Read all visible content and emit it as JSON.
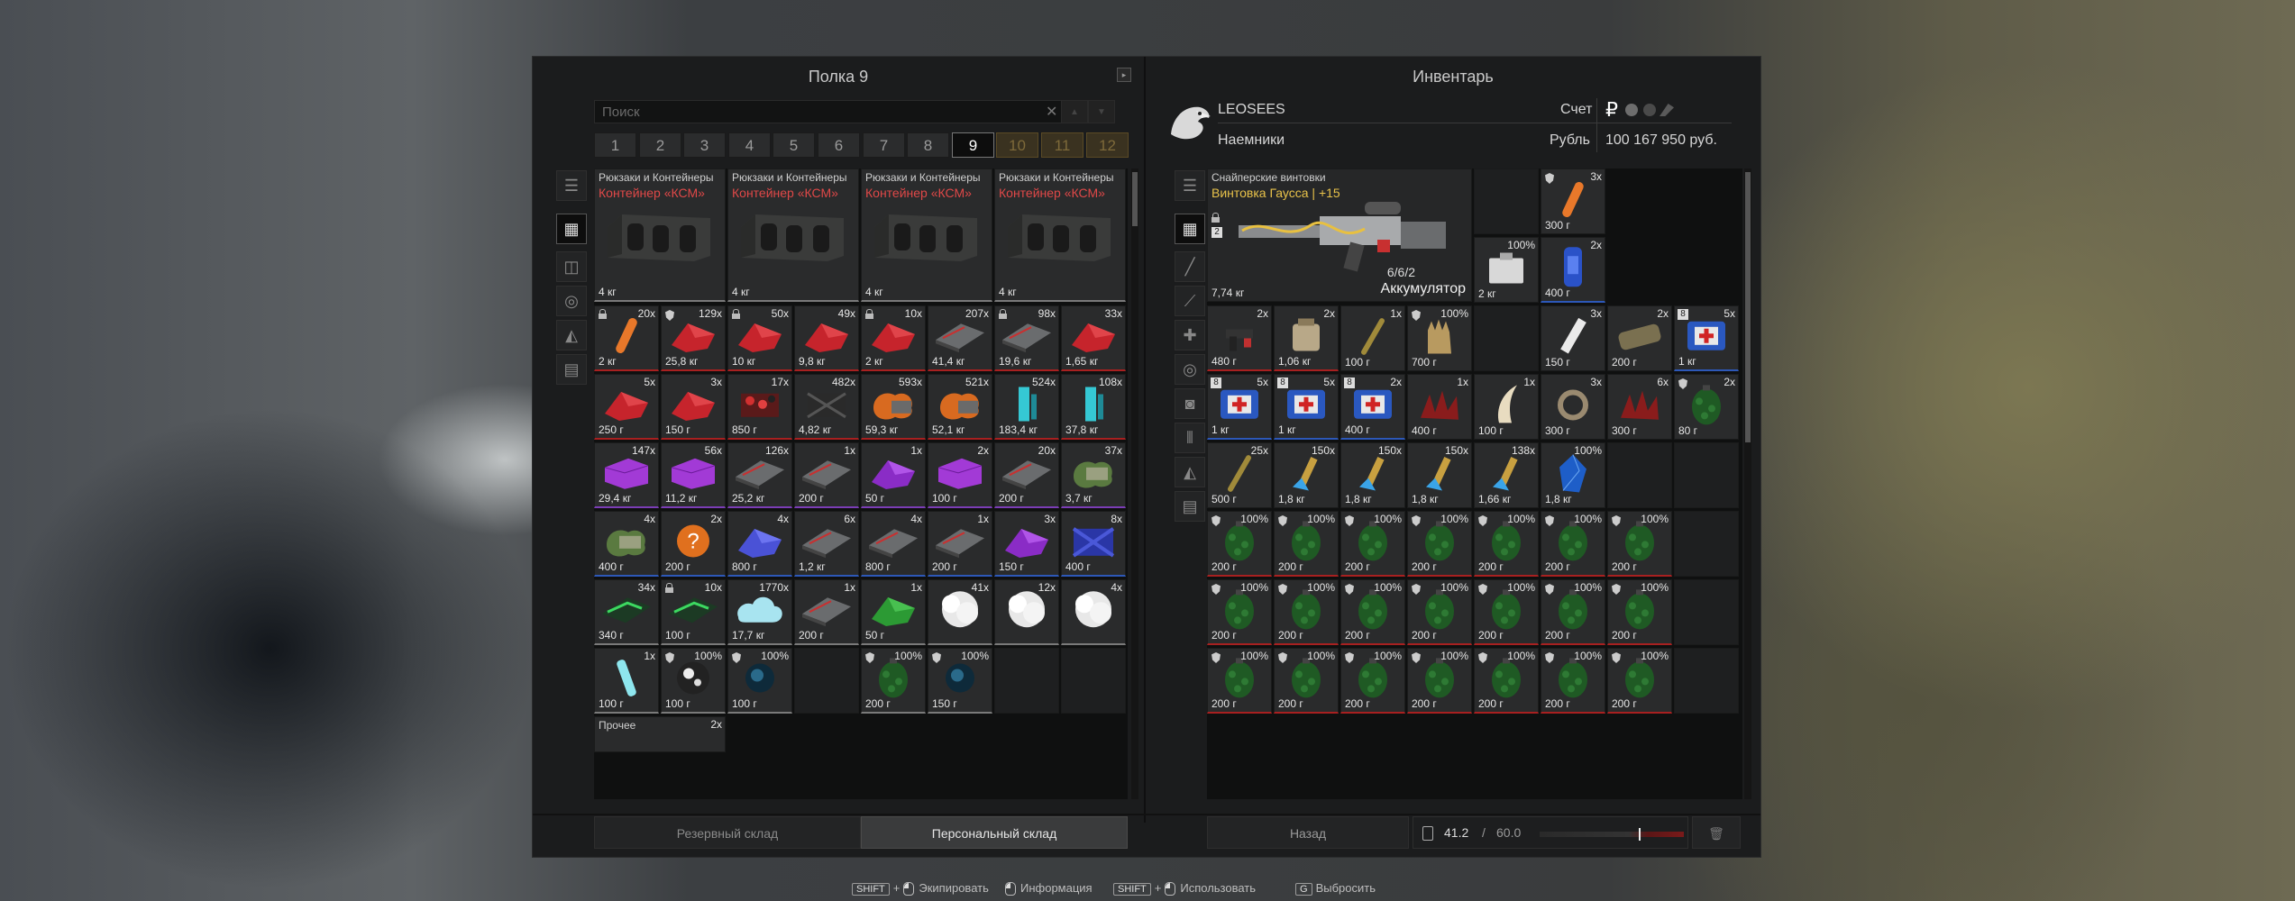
{
  "stash": {
    "title": "Полка 9",
    "search_placeholder": "Поиск",
    "pages": [
      "1",
      "2",
      "3",
      "4",
      "5",
      "6",
      "7",
      "8",
      "9",
      "10",
      "11",
      "12"
    ],
    "boxes": [
      {
        "category": "Рюкзаки и Контейнеры",
        "name": "Контейнер «КСМ»",
        "weight": "4 кг"
      },
      {
        "category": "Рюкзаки и Контейнеры",
        "name": "Контейнер «КСМ»",
        "weight": "4 кг"
      },
      {
        "category": "Рюкзаки и Контейнеры",
        "name": "Контейнер «КСМ»",
        "weight": "4 кг"
      },
      {
        "category": "Рюкзаки и Контейнеры",
        "name": "Контейнер «КСМ»",
        "weight": "4 кг"
      }
    ],
    "rows": [
      [
        {
          "c": "20x",
          "w": "2 кг",
          "k": "lock",
          "i": "stick-orange",
          "b": "rb"
        },
        {
          "c": "129x",
          "w": "25,8 кг",
          "k": "shield",
          "i": "crumb-red",
          "b": "rb"
        },
        {
          "c": "50x",
          "w": "10 кг",
          "k": "lock",
          "i": "crumb-red",
          "b": "rb"
        },
        {
          "c": "49x",
          "w": "9,8 кг",
          "k": "",
          "i": "crumb-red",
          "b": "rb"
        },
        {
          "c": "10x",
          "w": "2 кг",
          "k": "lock",
          "i": "crumb-red",
          "b": "rb"
        },
        {
          "c": "207x",
          "w": "41,4 кг",
          "k": "",
          "i": "plate-grey",
          "b": "rb"
        },
        {
          "c": "98x",
          "w": "19,6 кг",
          "k": "lock",
          "i": "plate-grey",
          "b": "rb"
        },
        {
          "c": "33x",
          "w": "1,65 кг",
          "k": "",
          "i": "crumb-red",
          "b": "rb"
        }
      ],
      [
        {
          "c": "5x",
          "w": "250 г",
          "k": "",
          "i": "crumb-red",
          "b": "rb"
        },
        {
          "c": "3x",
          "w": "150 г",
          "k": "",
          "i": "crumb-red",
          "b": "rb"
        },
        {
          "c": "17x",
          "w": "850 г",
          "k": "",
          "i": "box-red",
          "b": "rb"
        },
        {
          "c": "482x",
          "w": "4,82 кг",
          "k": "",
          "i": "box-dark",
          "b": "rb"
        },
        {
          "c": "593x",
          "w": "59,3 кг",
          "k": "",
          "i": "blob-orange",
          "b": "rb"
        },
        {
          "c": "521x",
          "w": "52,1 кг",
          "k": "",
          "i": "blob-orange",
          "b": "rb"
        },
        {
          "c": "524x",
          "w": "183,4 кг",
          "k": "",
          "i": "crystal-cyan",
          "b": "rb"
        },
        {
          "c": "108x",
          "w": "37,8 кг",
          "k": "",
          "i": "crystal-cyan",
          "b": "rb"
        }
      ],
      [
        {
          "c": "147x",
          "w": "29,4 кг",
          "k": "",
          "i": "box-purple",
          "b": "pb"
        },
        {
          "c": "56x",
          "w": "11,2 кг",
          "k": "",
          "i": "box-purple",
          "b": "pb"
        },
        {
          "c": "126x",
          "w": "25,2 кг",
          "k": "",
          "i": "plate-grey",
          "b": "pb"
        },
        {
          "c": "1x",
          "w": "200 г",
          "k": "",
          "i": "plate-grey",
          "b": "pb"
        },
        {
          "c": "1x",
          "w": "50 г",
          "k": "",
          "i": "crumb-purple",
          "b": "pb"
        },
        {
          "c": "2x",
          "w": "100 г",
          "k": "",
          "i": "box-purple",
          "b": "pb"
        },
        {
          "c": "20x",
          "w": "200 г",
          "k": "",
          "i": "plate-grey",
          "b": "pb"
        },
        {
          "c": "37x",
          "w": "3,7 кг",
          "k": "",
          "i": "blob-green",
          "b": "pb"
        }
      ],
      [
        {
          "c": "4x",
          "w": "400 г",
          "k": "",
          "i": "blob-green",
          "b": "bb"
        },
        {
          "c": "2x",
          "w": "200 г",
          "k": "",
          "i": "question",
          "b": "bb"
        },
        {
          "c": "4x",
          "w": "800 г",
          "k": "",
          "i": "crumb-blue",
          "b": "bb"
        },
        {
          "c": "6x",
          "w": "1,2 кг",
          "k": "",
          "i": "plate-grey",
          "b": "bb"
        },
        {
          "c": "4x",
          "w": "800 г",
          "k": "",
          "i": "plate-grey",
          "b": "bb"
        },
        {
          "c": "1x",
          "w": "200 г",
          "k": "",
          "i": "plate-grey",
          "b": "bb"
        },
        {
          "c": "3x",
          "w": "150 г",
          "k": "",
          "i": "crumb-purple",
          "b": "bb"
        },
        {
          "c": "8x",
          "w": "400 г",
          "k": "",
          "i": "box-blue",
          "b": "bb"
        }
      ],
      [
        {
          "c": "34x",
          "w": "340 г",
          "k": "",
          "i": "plate-green",
          "b": "gb"
        },
        {
          "c": "10x",
          "w": "100 г",
          "k": "lock",
          "i": "plate-green",
          "b": "gb"
        },
        {
          "c": "1770x",
          "w": "17,7 кг",
          "k": "",
          "i": "cloud-cyan",
          "b": "gb"
        },
        {
          "c": "1x",
          "w": "200 г",
          "k": "",
          "i": "plate-grey",
          "b": "gb"
        },
        {
          "c": "1x",
          "w": "50 г",
          "k": "",
          "i": "crumb-green",
          "b": "gb"
        },
        {
          "c": "41x",
          "w": "",
          "k": "",
          "i": "cloud-white",
          "b": "gb"
        },
        {
          "c": "12x",
          "w": "",
          "k": "",
          "i": "cloud-white",
          "b": "gb"
        },
        {
          "c": "4x",
          "w": "",
          "k": "",
          "i": "cloud-white",
          "b": "gb"
        }
      ],
      [
        {
          "c": "1x",
          "w": "100 г",
          "k": "",
          "i": "stick-cyan",
          "b": "gb"
        },
        {
          "c": "100%",
          "w": "100 г",
          "k": "shield",
          "i": "orb-white",
          "b": "gb"
        },
        {
          "c": "100%",
          "w": "100 г",
          "k": "shield",
          "i": "orb-blue",
          "b": "gb"
        },
        {
          "c": "",
          "w": "",
          "k": "",
          "i": "",
          "b": ""
        },
        {
          "c": "100%",
          "w": "200 г",
          "k": "shield",
          "i": "grenade",
          "b": "gb"
        },
        {
          "c": "100%",
          "w": "150 г",
          "k": "shield",
          "i": "orb-blue",
          "b": "gb"
        },
        {
          "c": "",
          "w": "",
          "k": "",
          "i": "",
          "b": ""
        },
        {
          "c": "",
          "w": "",
          "k": "",
          "i": "",
          "b": ""
        }
      ]
    ],
    "misc": {
      "category": "Прочее",
      "count": "2x"
    },
    "tab_reserve": "Резервный склад",
    "tab_personal": "Персональный склад"
  },
  "inventory": {
    "title": "Инвентарь",
    "player_name": "LEOSEES",
    "player_faction": "Наемники",
    "account_label": "Счет",
    "currency_label": "Рубль",
    "currency_symbol": "₽",
    "balance": "100 167 950 руб.",
    "weapon": {
      "category": "Снайперские винтовки",
      "name": "Винтовка Гаусса | +15",
      "ammo": "6/6/2",
      "ammo_type": "Аккумулятор",
      "weight": "7,74 кг",
      "slot": "2"
    },
    "side_items": [
      {
        "c": "3x",
        "w": "300 г",
        "i": "stick-orange"
      },
      {
        "c": "100%",
        "w": "2 кг",
        "i": "case-white"
      },
      {
        "c": "2x",
        "w": "400 г",
        "i": "can-blue"
      }
    ],
    "rows": [
      [
        {
          "c": "2x",
          "w": "480 г",
          "i": "gun-small",
          "k": "",
          "b": "rb"
        },
        {
          "c": "2x",
          "w": "1,06 кг",
          "i": "bag-tan",
          "k": "",
          "b": "rb"
        },
        {
          "c": "1x",
          "w": "100 г",
          "i": "stick-olive",
          "k": "",
          "b": ""
        },
        {
          "c": "100%",
          "w": "700 г",
          "i": "glove-tan",
          "k": "shield",
          "b": ""
        },
        {
          "c": "",
          "w": "",
          "i": "",
          "k": "",
          "b": ""
        },
        {
          "c": "3x",
          "w": "150 г",
          "i": "tube-white",
          "k": "",
          "b": ""
        },
        {
          "c": "2x",
          "w": "200 г",
          "i": "bag-olive",
          "k": "",
          "b": ""
        },
        {
          "c": "5x",
          "w": "1 кг",
          "i": "medkit",
          "k": "8",
          "b": "bb"
        }
      ],
      [
        {
          "c": "5x",
          "w": "1 кг",
          "i": "medkit",
          "k": "8",
          "b": "bb"
        },
        {
          "c": "5x",
          "w": "1 кг",
          "i": "medkit",
          "k": "8",
          "b": "bb"
        },
        {
          "c": "2x",
          "w": "400 г",
          "i": "medkit",
          "k": "8",
          "b": "bb"
        },
        {
          "c": "1x",
          "w": "400 г",
          "i": "spike-red",
          "k": "",
          "b": ""
        },
        {
          "c": "1x",
          "w": "100 г",
          "i": "horn",
          "k": "",
          "b": ""
        },
        {
          "c": "3x",
          "w": "300 г",
          "i": "ring",
          "k": "",
          "b": ""
        },
        {
          "c": "6x",
          "w": "300 г",
          "i": "spike-red",
          "k": "",
          "b": ""
        },
        {
          "c": "2x",
          "w": "80 г",
          "i": "grenade",
          "k": "shield",
          "b": ""
        }
      ],
      [
        {
          "c": "25x",
          "w": "500 г",
          "i": "stick-olive",
          "k": "",
          "b": ""
        },
        {
          "c": "150x",
          "w": "1,8 кг",
          "i": "bullet",
          "k": "",
          "b": ""
        },
        {
          "c": "150x",
          "w": "1,8 кг",
          "i": "bullet",
          "k": "",
          "b": ""
        },
        {
          "c": "150x",
          "w": "1,8 кг",
          "i": "bullet",
          "k": "",
          "b": ""
        },
        {
          "c": "138x",
          "w": "1,66 кг",
          "i": "bullet",
          "k": "",
          "b": ""
        },
        {
          "c": "100%",
          "w": "1,8 кг",
          "i": "crystal-blue",
          "k": "",
          "b": ""
        },
        {
          "c": "",
          "w": "",
          "i": "",
          "k": "",
          "b": ""
        },
        {
          "c": "",
          "w": "",
          "i": "",
          "k": "",
          "b": ""
        }
      ],
      [
        {
          "c": "100%",
          "w": "200 г",
          "i": "grenade",
          "k": "shield",
          "b": "rb"
        },
        {
          "c": "100%",
          "w": "200 г",
          "i": "grenade",
          "k": "shield",
          "b": "rb"
        },
        {
          "c": "100%",
          "w": "200 г",
          "i": "grenade",
          "k": "shield",
          "b": "rb"
        },
        {
          "c": "100%",
          "w": "200 г",
          "i": "grenade",
          "k": "shield",
          "b": "rb"
        },
        {
          "c": "100%",
          "w": "200 г",
          "i": "grenade",
          "k": "shield",
          "b": "rb"
        },
        {
          "c": "100%",
          "w": "200 г",
          "i": "grenade",
          "k": "shield",
          "b": "rb"
        },
        {
          "c": "100%",
          "w": "200 г",
          "i": "grenade",
          "k": "shield",
          "b": "rb"
        },
        {
          "c": "",
          "w": "",
          "i": "",
          "k": "",
          "b": ""
        }
      ],
      [
        {
          "c": "100%",
          "w": "200 г",
          "i": "grenade",
          "k": "shield",
          "b": "rb"
        },
        {
          "c": "100%",
          "w": "200 г",
          "i": "grenade",
          "k": "shield",
          "b": "rb"
        },
        {
          "c": "100%",
          "w": "200 г",
          "i": "grenade",
          "k": "shield",
          "b": "rb"
        },
        {
          "c": "100%",
          "w": "200 г",
          "i": "grenade",
          "k": "shield",
          "b": "rb"
        },
        {
          "c": "100%",
          "w": "200 г",
          "i": "grenade",
          "k": "shield",
          "b": "rb"
        },
        {
          "c": "100%",
          "w": "200 г",
          "i": "grenade",
          "k": "shield",
          "b": "rb"
        },
        {
          "c": "100%",
          "w": "200 г",
          "i": "grenade",
          "k": "shield",
          "b": "rb"
        },
        {
          "c": "",
          "w": "",
          "i": "",
          "k": "",
          "b": ""
        }
      ],
      [
        {
          "c": "100%",
          "w": "200 г",
          "i": "grenade",
          "k": "shield",
          "b": "rb"
        },
        {
          "c": "100%",
          "w": "200 г",
          "i": "grenade",
          "k": "shield",
          "b": "rb"
        },
        {
          "c": "100%",
          "w": "200 г",
          "i": "grenade",
          "k": "shield",
          "b": "rb"
        },
        {
          "c": "100%",
          "w": "200 г",
          "i": "grenade",
          "k": "shield",
          "b": "rb"
        },
        {
          "c": "100%",
          "w": "200 г",
          "i": "grenade",
          "k": "shield",
          "b": "rb"
        },
        {
          "c": "100%",
          "w": "200 г",
          "i": "grenade",
          "k": "shield",
          "b": "rb"
        },
        {
          "c": "100%",
          "w": "200 г",
          "i": "grenade",
          "k": "shield",
          "b": "rb"
        },
        {
          "c": "",
          "w": "",
          "i": "",
          "k": "",
          "b": ""
        }
      ]
    ],
    "back_label": "Назад",
    "weight_current": "41.2",
    "weight_sep": "/",
    "weight_max": "60.0",
    "weight_fraction": 0.687
  },
  "hints": [
    {
      "key": "SHIFT",
      "plus": "+",
      "label": "Экипировать",
      "mouse": true
    },
    {
      "key": "",
      "plus": "",
      "label": "Информация",
      "mouse": true
    },
    {
      "key": "SHIFT",
      "plus": "+",
      "label": "Использовать",
      "mouse": true
    },
    {
      "key": "G",
      "plus": "",
      "label": "Выбросить",
      "mouse": false
    }
  ]
}
